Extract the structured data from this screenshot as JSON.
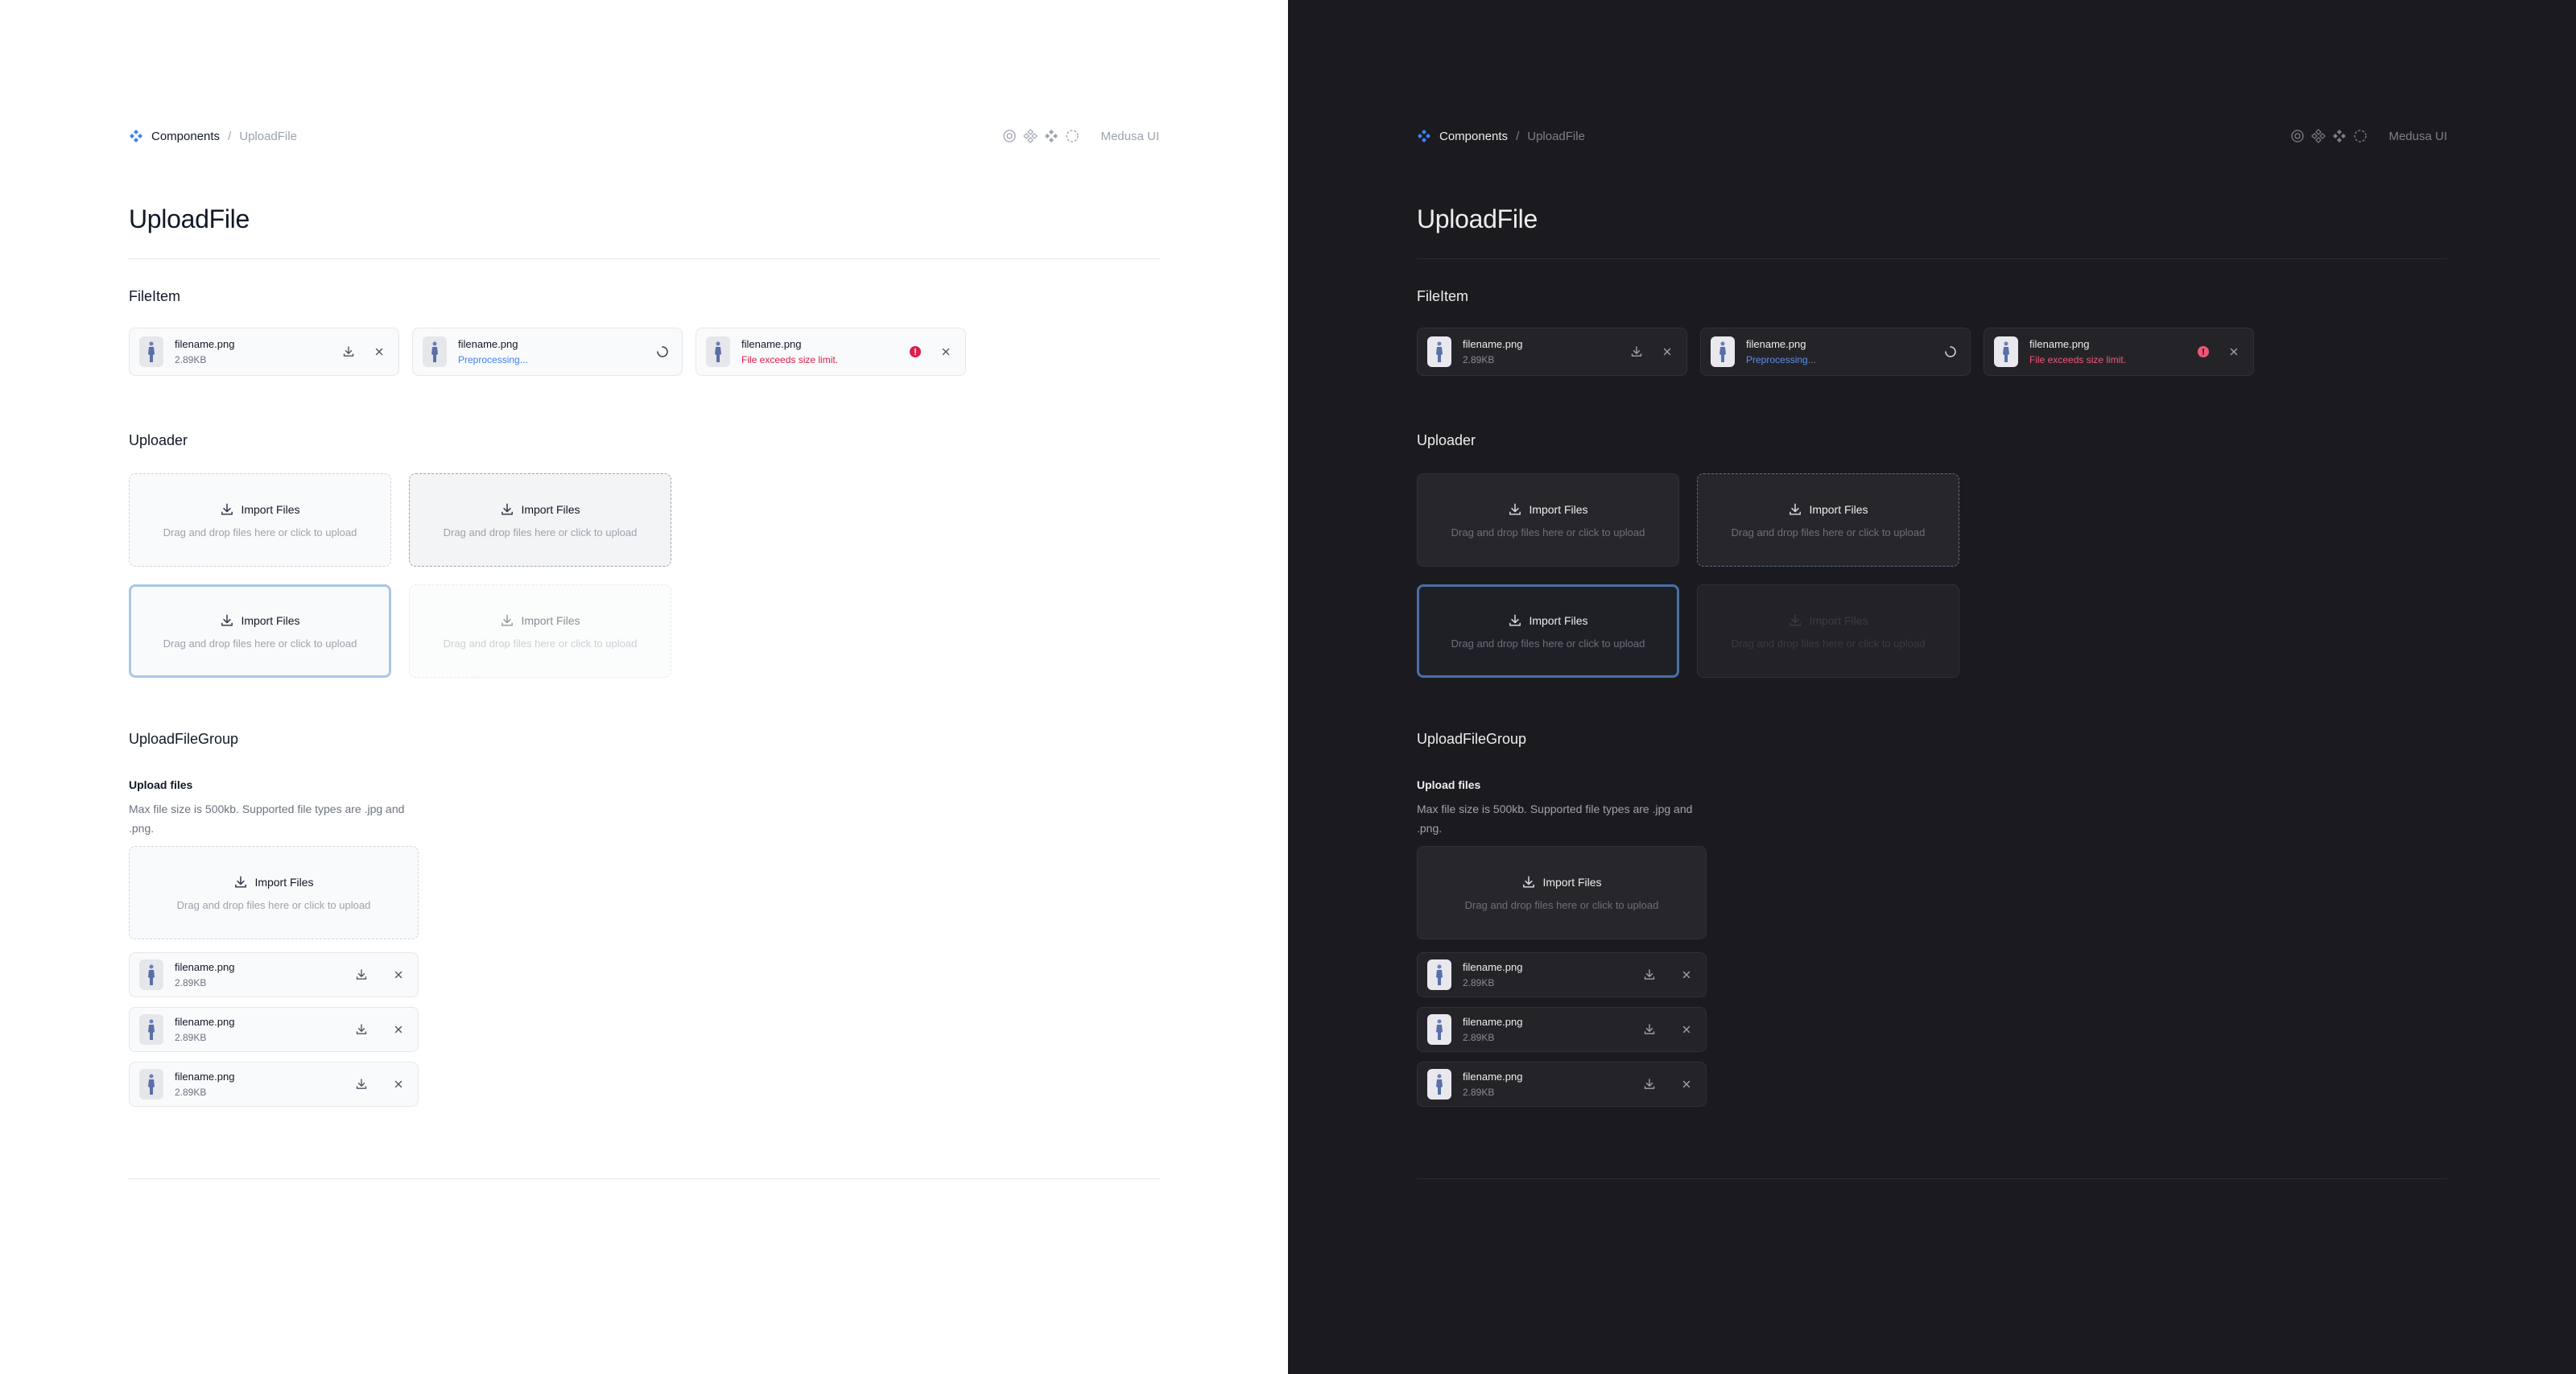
{
  "breadcrumb": {
    "root": "Components",
    "separator": "/",
    "current": "UploadFile"
  },
  "brand": {
    "name": "Medusa UI",
    "icons": [
      "at-sign-icon",
      "diamond-icon",
      "grid-diamond-icon",
      "dashed-circle-icon"
    ]
  },
  "page": {
    "title": "UploadFile"
  },
  "sections": {
    "file_item": "FileItem",
    "uploader": "Uploader",
    "group": "UploadFileGroup"
  },
  "file_items": [
    {
      "name": "filename.png",
      "meta": "2.89KB",
      "state": "default"
    },
    {
      "name": "filename.png",
      "meta": "Preprocessing...",
      "state": "loading"
    },
    {
      "name": "filename.png",
      "meta": "File exceeds size limit.",
      "state": "error"
    }
  ],
  "uploader": {
    "title": "Import Files",
    "hint": "Drag and drop files here or click to upload",
    "states": [
      "default",
      "hover",
      "focus",
      "disabled"
    ]
  },
  "group": {
    "title": "Upload files",
    "description": "Max file size is 500kb. Supported file types are .jpg and .png.",
    "files": [
      {
        "name": "filename.png",
        "meta": "2.89KB"
      },
      {
        "name": "filename.png",
        "meta": "2.89KB"
      },
      {
        "name": "filename.png",
        "meta": "2.89KB"
      }
    ]
  },
  "colors": {
    "light_bg": "#ffffff",
    "dark_bg": "#1b1b1f",
    "accent": "#3b82f6",
    "error": "#e11d48",
    "focus_ring": "#a9c7e8"
  }
}
